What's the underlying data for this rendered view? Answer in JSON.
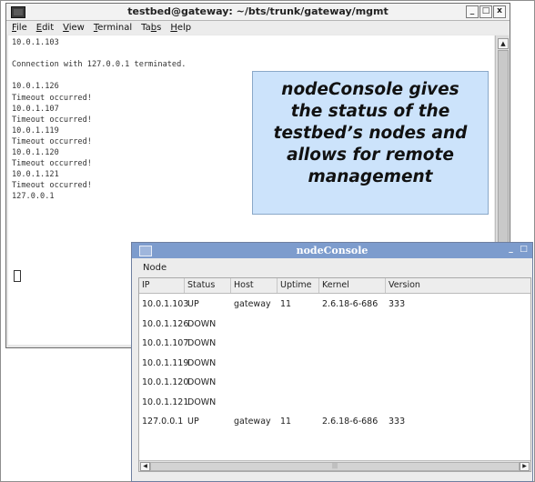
{
  "terminal": {
    "title": "testbed@gateway: ~/bts/trunk/gateway/mgmt",
    "menu": [
      "File",
      "Edit",
      "View",
      "Terminal",
      "Tabs",
      "Help"
    ],
    "menu_underline": [
      "F",
      "E",
      "V",
      "T",
      "b",
      "H"
    ],
    "lines": [
      "10.0.1.103",
      "",
      "Connection with 127.0.0.1 terminated.",
      "",
      "10.0.1.126",
      "Timeout occurred!",
      "10.0.1.107",
      "Timeout occurred!",
      "10.0.1.119",
      "Timeout occurred!",
      "10.0.1.120",
      "Timeout occurred!",
      "10.0.1.121",
      "Timeout occurred!",
      "127.0.0.1"
    ],
    "window_buttons": [
      "_",
      "□",
      "x"
    ]
  },
  "callout": {
    "lines": [
      "nodeConsole gives",
      "the status of the",
      "testbed’s nodes and",
      "allows for remote",
      "management"
    ]
  },
  "node_console": {
    "title": "nodeConsole",
    "menu": "Node",
    "columns": [
      "IP",
      "Status",
      "Host",
      "Uptime",
      "Kernel",
      "Version"
    ],
    "rows": [
      {
        "ip": "10.0.1.103",
        "status": "UP",
        "host": "gateway",
        "uptime": "11",
        "kernel": "2.6.18-6-686",
        "version": "333"
      },
      {
        "ip": "10.0.1.126",
        "status": "DOWN",
        "host": "",
        "uptime": "",
        "kernel": "",
        "version": ""
      },
      {
        "ip": "10.0.1.107",
        "status": "DOWN",
        "host": "",
        "uptime": "",
        "kernel": "",
        "version": ""
      },
      {
        "ip": "10.0.1.119",
        "status": "DOWN",
        "host": "",
        "uptime": "",
        "kernel": "",
        "version": ""
      },
      {
        "ip": "10.0.1.120",
        "status": "DOWN",
        "host": "",
        "uptime": "",
        "kernel": "",
        "version": ""
      },
      {
        "ip": "10.0.1.121",
        "status": "DOWN",
        "host": "",
        "uptime": "",
        "kernel": "",
        "version": ""
      },
      {
        "ip": "127.0.0.1",
        "status": "UP",
        "host": "gateway",
        "uptime": "11",
        "kernel": "2.6.18-6-686",
        "version": "333"
      }
    ],
    "window_buttons": [
      "_",
      "□"
    ]
  },
  "colors": {
    "callout_bg": "#cce3fb",
    "nodeconsole_titlebar": "#7d9ccd"
  }
}
